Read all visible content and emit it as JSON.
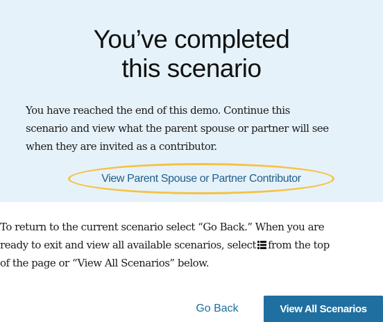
{
  "completion_panel": {
    "title_line1": "You’ve completed",
    "title_line2": "this scenario",
    "intro_line1": "You have reached the end of this demo. Continue this",
    "intro_line2": "scenario and view what the parent spouse or partner will see",
    "intro_line3": "when they are invited as a contributor.",
    "contributor_link_label": "View Parent Spouse or Partner Contributor",
    "highlight_color": "#f5c242",
    "background_color": "#e6f2f9"
  },
  "instructions": {
    "line1": "To return to the current scenario select “Go Back.” When you are",
    "line2_before_icon": "ready to exit and view all available scenarios, select",
    "line2_after_icon": "from the top",
    "line3": "of the page or “View All Scenarios” below.",
    "icon": "list-menu-icon"
  },
  "actions": {
    "go_back_label": "Go Back",
    "view_all_label": "View All Scenarios",
    "primary_color": "#1f6fa0"
  }
}
